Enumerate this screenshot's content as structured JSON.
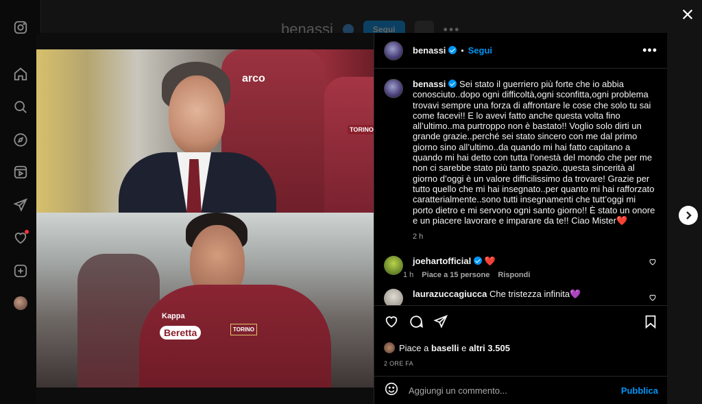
{
  "background": {
    "username": "benassi",
    "follow_label": "Segui",
    "more": "•••"
  },
  "icons": {
    "rail": [
      "instagram-icon",
      "home-icon",
      "search-icon",
      "explore-icon",
      "reels-icon",
      "messages-icon",
      "notifications-icon",
      "create-icon",
      "profile-avatar"
    ],
    "close": "close-icon",
    "next": "chevron-right-icon"
  },
  "colors": {
    "accent": "#0095f6",
    "background": "#000000",
    "muted": "#a8a8a8",
    "heart": "#ff3040"
  },
  "media": {
    "top_sponsor": "arco",
    "top_crest": "TORINO",
    "bottom_sponsor_1": "Kappa",
    "bottom_sponsor_2": "Beretta",
    "bottom_crest": "TORINO"
  },
  "post": {
    "username": "benassi",
    "separator": "•",
    "follow_label": "Segui",
    "more": "•••",
    "caption": "Sei stato il guerriero più forte che io abbia conosciuto..dopo ogni difficoltà,ogni sconfitta,ogni problema trovavi sempre una forza di affrontare le cose che solo tu sai come facevi!! E lo avevi fatto anche questa volta fino all’ultimo..ma purtroppo non è bastato!! Voglio solo dirti un grande grazie..perché sei stato sincero con me dal primo giorno sino all’ultimo..da quando mi hai fatto capitano a quando mi hai detto con tutta l’onestà del mondo che per me non ci sarebbe stato più tanto spazio..questa sincerità al giorno d’oggi è un valore difficilissimo da trovare! Grazie per tutto quello che mi hai insegnato..per quanto mi hai rafforzato caratterialmente..sono tutti insegnamenti che tutt’oggi mi porto dietro e mi servono ogni santo giorno!! È stato un onore e un piacere lavorare e imparare da te!! Ciao Mister",
    "caption_emoji": "❤️",
    "caption_time": "2 h",
    "comments": [
      {
        "username": "joehartofficial",
        "text": "❤️",
        "time": "1 h",
        "likes": "Piace a 15 persone",
        "reply": "Rispondi"
      },
      {
        "username": "laurazuccagiucca",
        "text": "Che tristezza infinita",
        "emoji": "💜"
      }
    ],
    "likes_prefix": "Piace a",
    "likes_user": "baselli",
    "likes_mid": "e",
    "likes_count": "altri 3.505",
    "time_ago": "2 ORE FA",
    "comment_placeholder": "Aggiungi un commento...",
    "publish_label": "Pubblica"
  }
}
